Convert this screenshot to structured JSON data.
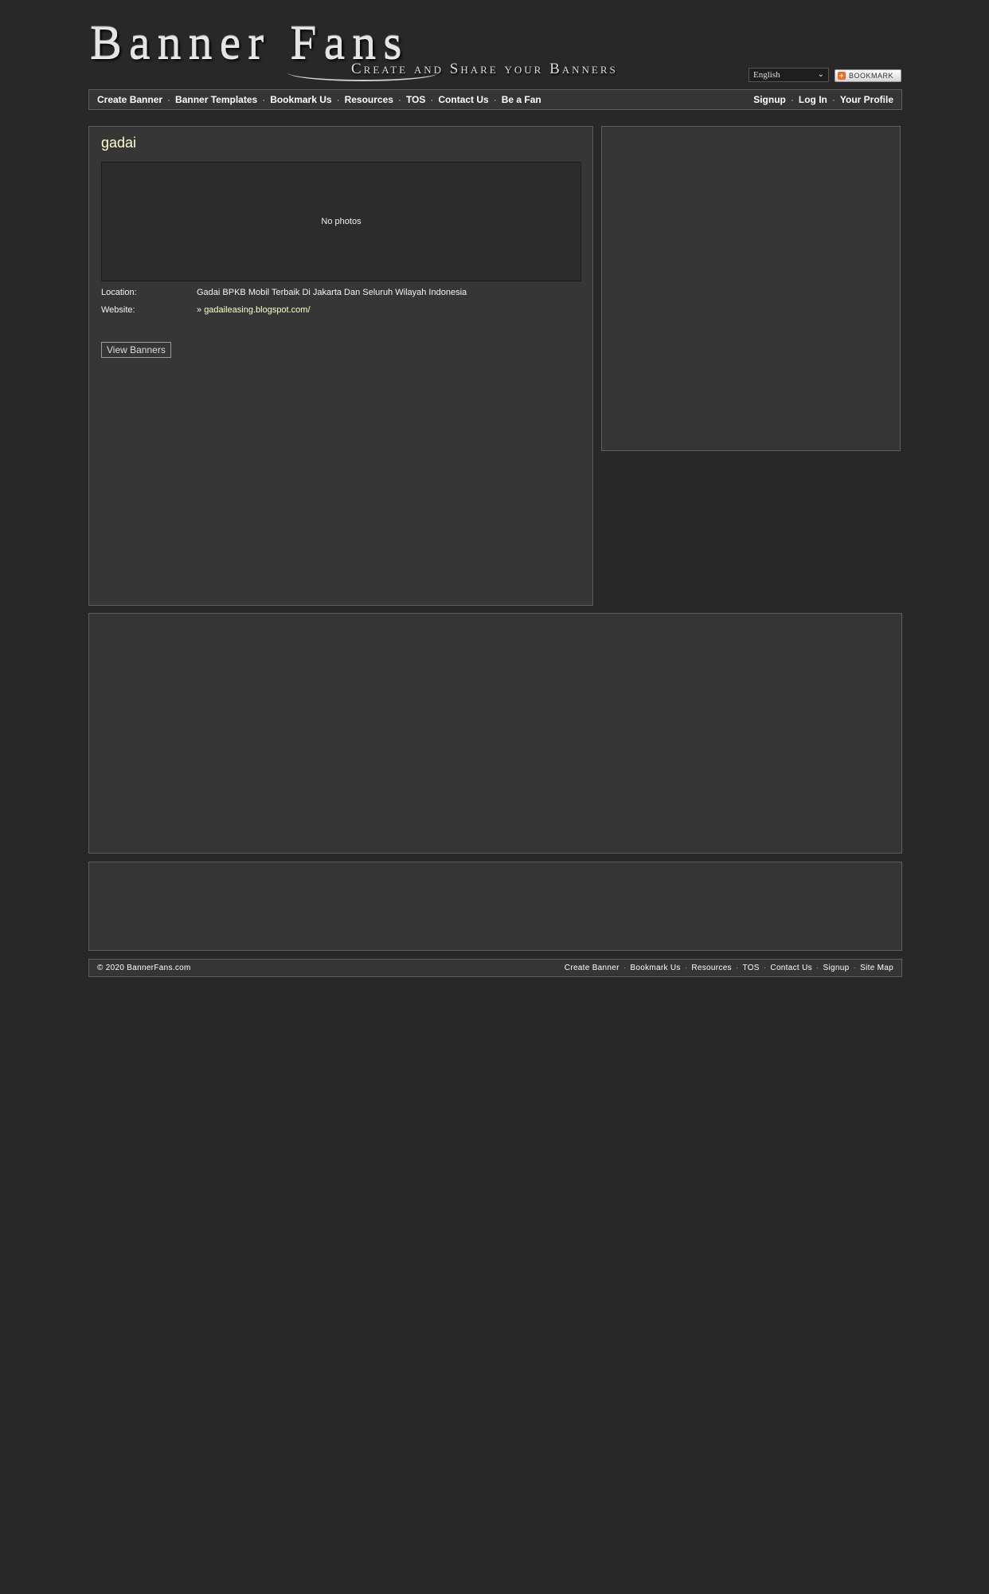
{
  "header": {
    "logo_title": "Banner Fans",
    "logo_tagline": "Create and Share your Banners",
    "language": "English",
    "bookmark_label": "BOOKMARK"
  },
  "nav": {
    "left": [
      "Create Banner",
      "Banner Templates",
      "Bookmark Us",
      "Resources",
      "TOS",
      "Contact Us",
      "Be a Fan"
    ],
    "right": [
      "Signup",
      "Log In",
      "Your Profile"
    ]
  },
  "profile": {
    "name": "gadai",
    "photos_text": "No photos",
    "location_label": "Location:",
    "location_value": "Gadai BPKB Mobil Terbaik Di Jakarta Dan Seluruh Wilayah Indonesia",
    "website_label": "Website:",
    "website_prefix": "»",
    "website_value": "gadaileasing.blogspot.com/",
    "view_banners_label": "View Banners"
  },
  "footer": {
    "copyright": "© 2020 BannerFans.com",
    "links": [
      "Create Banner",
      "Bookmark Us",
      "Resources",
      "TOS",
      "Contact Us",
      "Signup",
      "Site Map"
    ]
  },
  "colors": {
    "background": "#282828",
    "panel": "#363636",
    "border": "#5e5e5e",
    "accent_text": "#ffffcc"
  }
}
